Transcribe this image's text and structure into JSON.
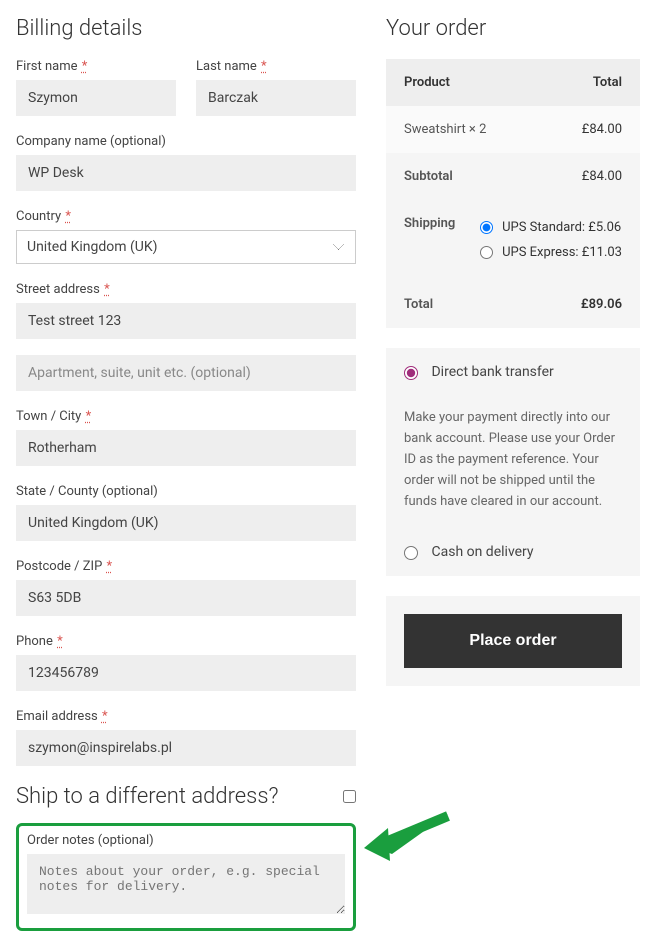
{
  "billing": {
    "heading": "Billing details",
    "first_name": {
      "label": "First name",
      "value": "Szymon"
    },
    "last_name": {
      "label": "Last name",
      "value": "Barczak"
    },
    "company": {
      "label": "Company name (optional)",
      "value": "WP Desk"
    },
    "country": {
      "label": "Country",
      "value": "United Kingdom (UK)"
    },
    "street1": {
      "label": "Street address",
      "value": "Test street 123"
    },
    "street2_placeholder": "Apartment, suite, unit etc. (optional)",
    "city": {
      "label": "Town / City",
      "value": "Rotherham"
    },
    "state": {
      "label": "State / County (optional)",
      "value": "United Kingdom (UK)"
    },
    "postcode": {
      "label": "Postcode / ZIP",
      "value": "S63 5DB"
    },
    "phone": {
      "label": "Phone",
      "value": "123456789"
    },
    "email": {
      "label": "Email address",
      "value": "szymon@inspirelabs.pl"
    }
  },
  "ship_heading": "Ship to a different address?",
  "notes": {
    "label": "Order notes (optional)",
    "placeholder": "Notes about your order, e.g. special notes for delivery."
  },
  "order": {
    "heading": "Your order",
    "columns": {
      "product": "Product",
      "total": "Total"
    },
    "line": {
      "name": "Sweatshirt  × 2",
      "total": "£84.00"
    },
    "subtotal": {
      "label": "Subtotal",
      "value": "£84.00"
    },
    "shipping": {
      "label": "Shipping",
      "option1": "UPS Standard: £5.06",
      "option2": "UPS Express: £11.03"
    },
    "total": {
      "label": "Total",
      "value": "£89.06"
    }
  },
  "payment": {
    "bank": {
      "label": "Direct bank transfer",
      "desc": "Make your payment directly into our bank account. Please use your Order ID as the payment reference. Your order will not be shipped until the funds have cleared in our account."
    },
    "cod": {
      "label": "Cash on delivery"
    }
  },
  "place_order": "Place order"
}
